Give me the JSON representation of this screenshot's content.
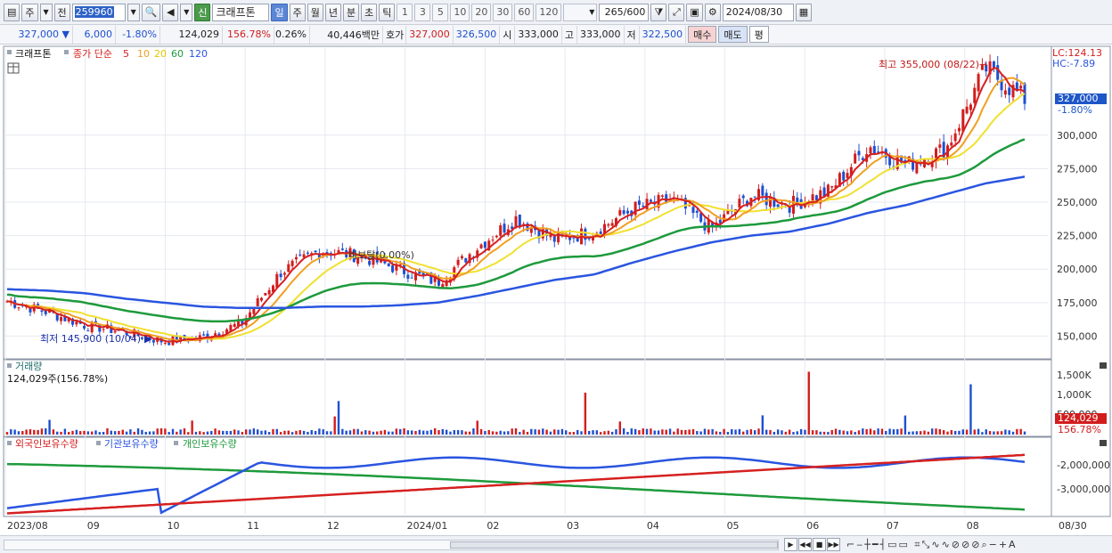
{
  "toolbar": {
    "period_selector": "주",
    "prev_label": "전",
    "code": "259960",
    "badge": "신",
    "stock_name": "크래프톤",
    "periods": [
      "일",
      "주",
      "월",
      "년",
      "분",
      "초",
      "틱"
    ],
    "active_period": "일",
    "minutes": [
      "1",
      "3",
      "5",
      "10",
      "20",
      "30",
      "60",
      "120"
    ],
    "count": "265/600",
    "date": "2024/08/30"
  },
  "quote": {
    "price": "327,000",
    "change": "6,000",
    "change_pct": "-1.80%",
    "volume": "124,029",
    "volume_ratio": "156.78%",
    "turnover_pct": "0.26%",
    "amount": "40,446백만",
    "bid_label": "호가",
    "ask_price": "327,000",
    "bid_price": "326,500",
    "open_label": "시",
    "open": "333,000",
    "high_label": "고",
    "high": "333,000",
    "low_label": "저",
    "low": "322,500",
    "buy_label": "매수",
    "sell_label": "매도",
    "misc_label": "평"
  },
  "price_panel": {
    "legend_name": "크래프톤",
    "legend_label": "종가 단순",
    "ma_periods": [
      "5",
      "10",
      "20",
      "60",
      "120"
    ],
    "ma_colors": [
      "#d62020",
      "#f0a020",
      "#f0e030",
      "#1e9a3c",
      "#2a55e0"
    ],
    "high_annotation": "최고 355,000 (08/22)",
    "low_annotation": "최저 145,900 (10/04)",
    "mid_annotation": "비보탈(0.00%)",
    "lc": "LC:124.13",
    "hc": "HC:-7.89",
    "price_tag": "327,000",
    "pct_tag": "-1.80%",
    "y_ticks": [
      "300,000",
      "275,000",
      "250,000",
      "225,000",
      "200,000",
      "175,000",
      "150,000"
    ],
    "y_tick_values": [
      300000,
      275000,
      250000,
      225000,
      200000,
      175000,
      150000
    ]
  },
  "volume_panel": {
    "title": "거래량",
    "value": "124,029주(156.78%)",
    "y_ticks": [
      "1,500K",
      "1,000K",
      "500,000"
    ],
    "tag_value": "124,029",
    "tag_pct": "156.78%"
  },
  "holding_panel": {
    "legend": [
      "외국인보유수량",
      "기관보유수량",
      "개인보유수량"
    ],
    "colors": [
      "#d62020",
      "#2a55e0",
      "#1e9a3c"
    ],
    "y_ticks": [
      "-2,000,000",
      "-3,000,000"
    ]
  },
  "x_axis": {
    "labels": [
      "2023/08",
      "09",
      "10",
      "11",
      "12",
      "2024/01",
      "02",
      "03",
      "04",
      "05",
      "06",
      "07",
      "08"
    ],
    "end_label": "08/30"
  },
  "chart_data": {
    "type": "line",
    "x": [
      "2023-08-01",
      "2023-08-15",
      "2023-09-01",
      "2023-09-15",
      "2023-10-04",
      "2023-10-15",
      "2023-11-01",
      "2023-11-15",
      "2023-12-01",
      "2023-12-15",
      "2024-01-02",
      "2024-01-15",
      "2024-02-01",
      "2024-02-15",
      "2024-03-01",
      "2024-03-15",
      "2024-04-01",
      "2024-04-15",
      "2024-05-01",
      "2024-05-15",
      "2024-06-01",
      "2024-06-15",
      "2024-07-01",
      "2024-07-15",
      "2024-08-01",
      "2024-08-22",
      "2024-08-30"
    ],
    "series": [
      {
        "name": "5",
        "values": [
          176000,
          168000,
          158000,
          153000,
          146000,
          149000,
          160000,
          198000,
          214000,
          210000,
          200000,
          190000,
          216000,
          238000,
          222000,
          228000,
          245000,
          252000,
          230000,
          255000,
          248000,
          258000,
          292000,
          278000,
          290000,
          350000,
          327000
        ]
      },
      {
        "name": "120",
        "values": [
          185000,
          184000,
          182000,
          178000,
          175000,
          172000,
          171000,
          171000,
          172000,
          172000,
          173000,
          175000,
          180000,
          186000,
          192000,
          196000,
          205000,
          213000,
          220000,
          225000,
          228000,
          234000,
          242000,
          248000,
          256000,
          264000,
          269000
        ]
      }
    ]
  }
}
